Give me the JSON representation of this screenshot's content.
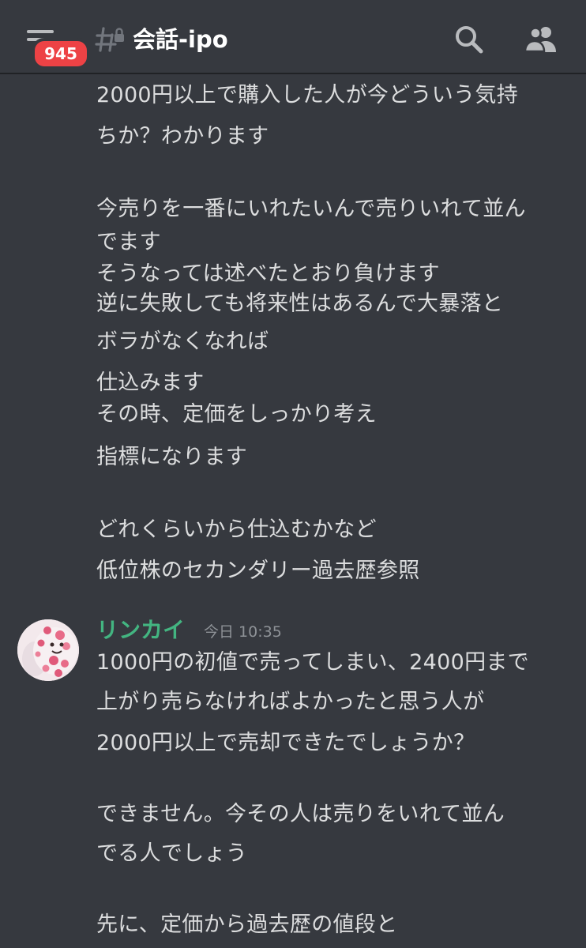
{
  "header": {
    "badge_count": "945",
    "channel_name": "会話-ipo",
    "icons": {
      "menu": "hamburger-menu-icon",
      "channel": "locked-text-channel-icon",
      "search": "search-icon",
      "members": "members-icon"
    }
  },
  "colors": {
    "background": "#36393f",
    "badge": "#ed4245",
    "author": "#43b581",
    "text": "#dcddde",
    "timestamp": "#8e9297"
  },
  "messages": {
    "previous": {
      "lines": [
        "2000円以上で購入した人が今どういう気持",
        "ちか？わかります",
        "今売りを一番にいれたいんで売りいれて並ん",
        "でます",
        "そうなっては述べたとおり負けます",
        "逆に失敗しても将来性はあるんで大暴落と",
        "ボラがなくなれば",
        "仕込みます",
        "その時、定価をしっかり考え",
        "指標になります",
        "どれくらいから仕込むかなど",
        "低位株のセカンダリー過去歴参照"
      ]
    },
    "current": {
      "author": "リンカイ",
      "timestamp": "今日 10:35",
      "lines": [
        "1000円の初値で売ってしまい、2400円まで",
        "上がり売らなければよかったと思う人が",
        "2000円以上で売却できたでしょうか？",
        "できません。今その人は売りをいれて並ん",
        "でる人でしょう",
        "先に、定価から過去歴の値段と"
      ]
    }
  }
}
